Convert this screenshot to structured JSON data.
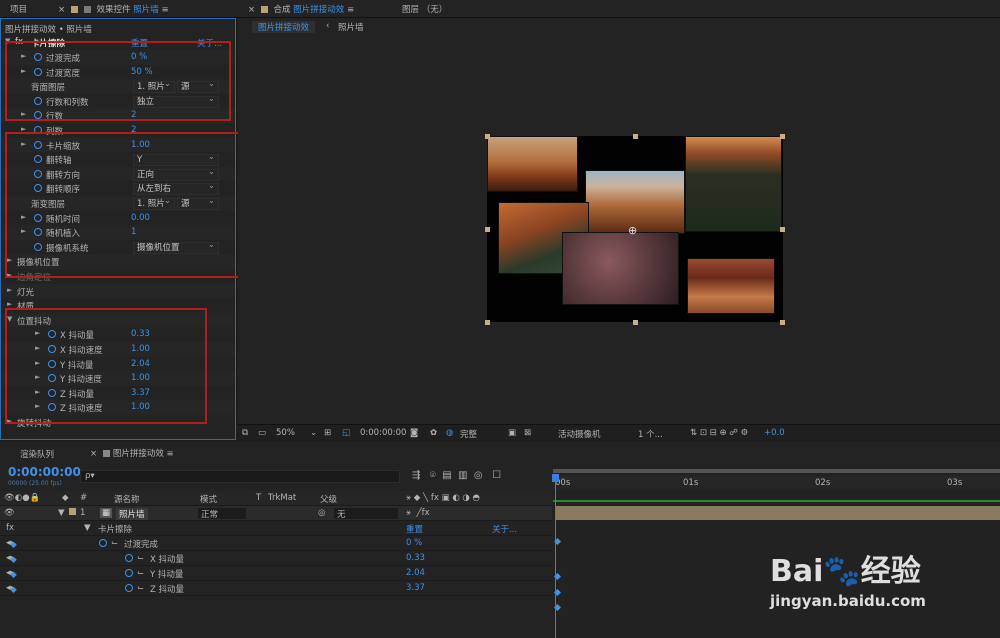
{
  "tabs": {
    "project": "项目",
    "effects_prefix": "效果控件",
    "effects_target": "照片墙",
    "comp_prefix": "合成",
    "comp_target": "图片拼接动效",
    "layer": "图层 （无）"
  },
  "fx": {
    "breadcrumb": "图片拼接动效 • 照片墙",
    "effect_name": "卡片擦除",
    "reset": "重置",
    "about": "关于...",
    "rows": [
      {
        "label": "过渡完成",
        "value": "0 %"
      },
      {
        "label": "过渡宽度",
        "value": "50 %"
      },
      {
        "label": "背面图层",
        "dd1": "1. 照片",
        "dd2": "源"
      },
      {
        "label": "行数和列数",
        "dd": "独立"
      },
      {
        "label": "行数",
        "value": "2"
      },
      {
        "label": "列数",
        "value": "2"
      },
      {
        "label": "卡片缩放",
        "value": "1.00"
      },
      {
        "label": "翻转轴",
        "dd": "Y"
      },
      {
        "label": "翻转方向",
        "dd": "正向"
      },
      {
        "label": "翻转顺序",
        "dd": "从左到右"
      },
      {
        "label": "渐变图层",
        "dd1": "1. 照片",
        "dd2": "源"
      },
      {
        "label": "随机时间",
        "value": "0.00"
      },
      {
        "label": "随机植入",
        "value": "1"
      },
      {
        "label": "摄像机系统",
        "dd": "摄像机位置"
      },
      {
        "label": "摄像机位置"
      },
      {
        "label": "边角定位"
      },
      {
        "label": "灯光"
      },
      {
        "label": "材质"
      },
      {
        "label": "位置抖动"
      },
      {
        "label": "X 抖动量",
        "value": "0.33"
      },
      {
        "label": "X 抖动速度",
        "value": "1.00"
      },
      {
        "label": "Y 抖动量",
        "value": "2.04"
      },
      {
        "label": "Y 抖动速度",
        "value": "1.00"
      },
      {
        "label": "Z 抖动量",
        "value": "3.37"
      },
      {
        "label": "Z 抖动速度",
        "value": "1.00"
      },
      {
        "label": "旋转抖动"
      }
    ]
  },
  "comp": {
    "subtab": "图片拼接动效",
    "crumb": "照片墙"
  },
  "viewer_toolbar": {
    "zoom": "50%",
    "timecode": "0:00:00:00",
    "quality": "完整",
    "camera": "活动摄像机",
    "views": "1 个...",
    "exposure": "+0.0"
  },
  "timeline": {
    "render_queue": "渲染队列",
    "comp_tab": "图片拼接动效",
    "timecode": "0:00:00:00",
    "fps": "00000 (25.00 fps)",
    "search_placeholder": "ρ▾",
    "col_source": "源名称",
    "col_mode": "模式",
    "col_t": "T",
    "col_trkmat": "TrkMat",
    "col_parent": "父级",
    "layer_num": "1",
    "layer_name": "照片墙",
    "layer_mode": "正常",
    "layer_parent": "无",
    "effect_row": "卡片擦除",
    "reset": "重置",
    "about": "关于...",
    "props": [
      {
        "label": "过渡完成",
        "value": "0 %"
      },
      {
        "label": "X 抖动量",
        "value": "0.33"
      },
      {
        "label": "Y 抖动量",
        "value": "2.04"
      },
      {
        "label": "Z 抖动量",
        "value": "3.37"
      }
    ],
    "ruler": [
      "00s",
      "01s",
      "02s",
      "03s"
    ]
  },
  "watermark": {
    "brand": "Bai",
    "brand2": "经验",
    "url": "jingyan.baidu.com"
  }
}
